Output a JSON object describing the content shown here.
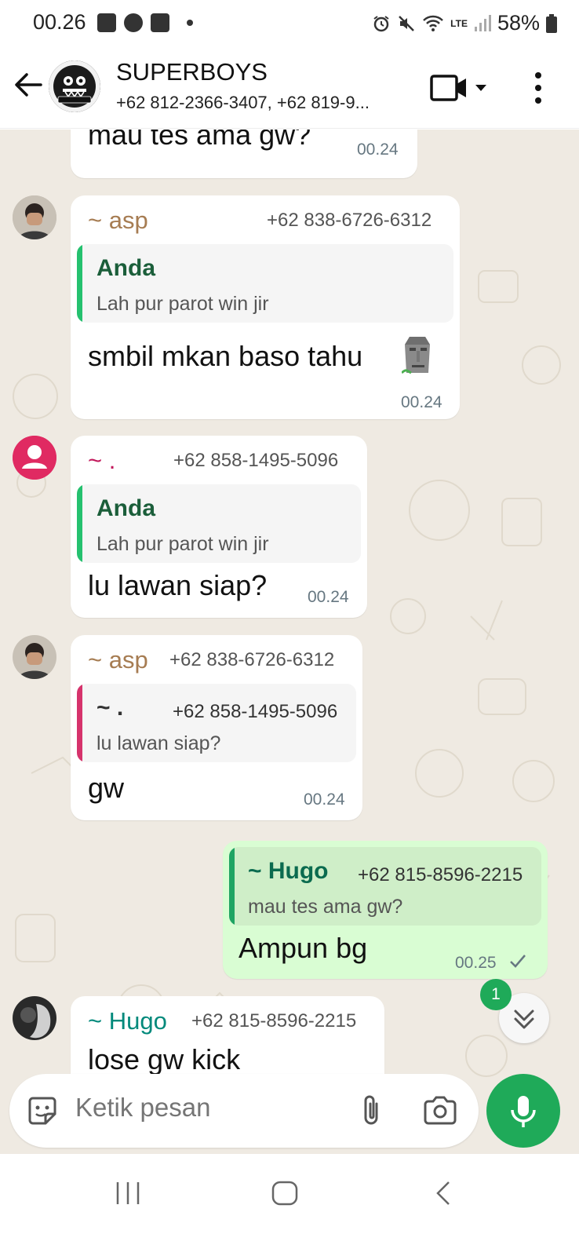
{
  "status_bar": {
    "time": "00.26",
    "battery": "58%",
    "network_label": "LTE"
  },
  "header": {
    "group_name": "SUPERBOYS",
    "participants": "+62 812-2366-3407, +62 819-9..."
  },
  "messages": {
    "m1": {
      "text": "mau tes ama gw?",
      "time": "00.24"
    },
    "m2": {
      "sender": "~ asp",
      "phone": "+62 838-6726-6312",
      "quote_name": "Anda",
      "quote_text": "Lah pur parot win jir",
      "text": "smbil mkan baso tahu",
      "time": "00.24"
    },
    "m3": {
      "sender": "~ .",
      "phone": "+62 858-1495-5096",
      "quote_name": "Anda",
      "quote_text": "Lah pur parot win jir",
      "text": "lu lawan siap?",
      "time": "00.24"
    },
    "m4": {
      "sender": "~ asp",
      "phone": "+62 838-6726-6312",
      "quote_name": "~ .",
      "quote_phone": "+62 858-1495-5096",
      "quote_text": "lu lawan siap?",
      "text": "gw",
      "time": "00.24"
    },
    "m5": {
      "quote_name": "~ Hugo",
      "quote_phone": "+62 815-8596-2215",
      "quote_text": "mau tes ama gw?",
      "text": "Ampun bg",
      "time": "00.25"
    },
    "m6": {
      "sender": "~ Hugo",
      "phone": "+62 815-8596-2215",
      "text": "lose gw kick"
    }
  },
  "unread_count": "1",
  "composer": {
    "placeholder": "Ketik pesan"
  },
  "colors": {
    "accent_green": "#1faa59",
    "sender_asp": "#a67c52",
    "sender_dot": "#c2185b",
    "quote_anda": "#1b5e3a",
    "sender_hugo": "#00897b",
    "quote_bar_green": "#25c16f",
    "quote_bar_pink": "#d6336c",
    "chat_bg": "#efeae2",
    "outgoing_bubble": "#d9fdd3"
  },
  "icons": {
    "back": "arrow-left-icon",
    "video": "video-camera-icon",
    "more": "more-vertical-icon",
    "emoji": "sticker-icon",
    "attach": "paperclip-icon",
    "camera": "camera-icon",
    "mic": "microphone-icon",
    "scroll": "double-chevron-down-icon",
    "read": "check-icon"
  }
}
